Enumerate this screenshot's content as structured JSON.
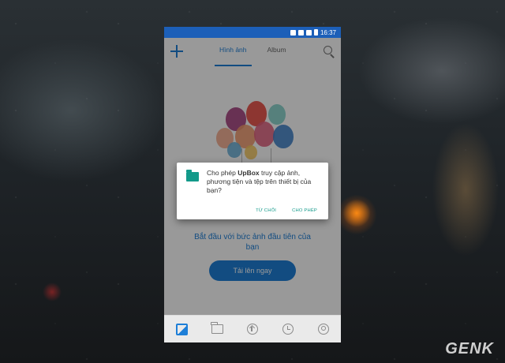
{
  "status_bar": {
    "time": "16:37",
    "battery": "47"
  },
  "app_bar": {
    "tabs": [
      {
        "label": "Hình ảnh",
        "active": true
      },
      {
        "label": "Album",
        "active": false
      }
    ],
    "add_icon": "plus-icon",
    "search_icon": "search-icon"
  },
  "empty_state": {
    "title": "Bắt đầu với bức ảnh đầu tiên của bạn",
    "upload_button": "Tải lên ngay"
  },
  "bottom_nav": {
    "items": [
      {
        "icon": "photos-icon",
        "active": true
      },
      {
        "icon": "folder-icon",
        "active": false
      },
      {
        "icon": "upload-icon",
        "active": false
      },
      {
        "icon": "recent-icon",
        "active": false
      },
      {
        "icon": "account-icon",
        "active": false
      }
    ]
  },
  "dialog": {
    "message_prefix": "Cho phép ",
    "app_name": "UpBox",
    "message_suffix": " truy cập ảnh, phương tiện và tệp trên thiết bị của bạn?",
    "deny_label": "TỪ CHỐI",
    "allow_label": "CHO PHÉP"
  },
  "watermark": {
    "text_main": "GEN",
    "text_end": "K"
  },
  "colors": {
    "accent": "#1e7fd8",
    "status_bar": "#1c5fb8",
    "dialog_accent": "#139a8a"
  }
}
